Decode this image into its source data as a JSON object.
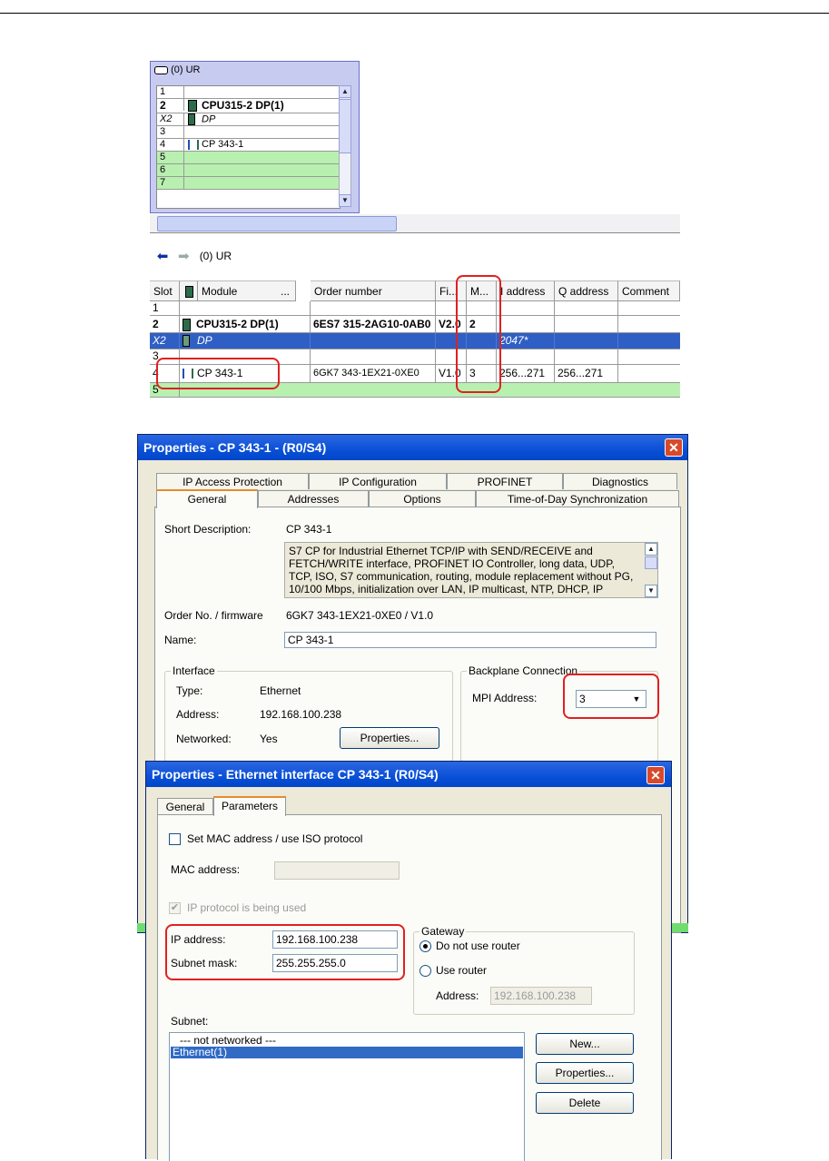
{
  "rack": {
    "title": "(0) UR",
    "rows": [
      {
        "slot": "1",
        "module": ""
      },
      {
        "slot": "2",
        "module": "CPU315-2 DP(1)"
      },
      {
        "slot": "X2",
        "module": "DP"
      },
      {
        "slot": "3",
        "module": ""
      },
      {
        "slot": "4",
        "module": "CP 343-1"
      },
      {
        "slot": "5",
        "module": ""
      },
      {
        "slot": "6",
        "module": ""
      },
      {
        "slot": "7",
        "module": ""
      }
    ]
  },
  "detail": {
    "nav_title": "(0)  UR",
    "headers": [
      "Slot",
      "Module",
      "...",
      "Order number",
      "Fi...",
      "M...",
      "I address",
      "Q address",
      "Comment"
    ],
    "rows": [
      {
        "slot": "1",
        "module": "",
        "order": "",
        "fw": "",
        "mpi": "",
        "i_addr": "",
        "q_addr": "",
        "comment": ""
      },
      {
        "slot": "2",
        "module": "CPU315-2 DP(1)",
        "order": "6ES7 315-2AG10-0AB0",
        "fw": "V2.0",
        "mpi": "2",
        "i_addr": "",
        "q_addr": "",
        "comment": ""
      },
      {
        "slot": "X2",
        "module": "DP",
        "order": "",
        "fw": "",
        "mpi": "",
        "i_addr": "2047*",
        "q_addr": "",
        "comment": ""
      },
      {
        "slot": "3",
        "module": "",
        "order": "",
        "fw": "",
        "mpi": "",
        "i_addr": "",
        "q_addr": "",
        "comment": ""
      },
      {
        "slot": "4",
        "module": "CP 343-1",
        "order": "6GK7 343-1EX21-0XE0",
        "fw": "V1.0",
        "mpi": "3",
        "i_addr": "256...271",
        "q_addr": "256...271",
        "comment": ""
      },
      {
        "slot": "5",
        "module": "",
        "order": "",
        "fw": "",
        "mpi": "",
        "i_addr": "",
        "q_addr": "",
        "comment": ""
      }
    ]
  },
  "props": {
    "title": "Properties - CP 343-1 - (R0/S4)",
    "tabs_back": [
      "IP Access Protection",
      "IP Configuration",
      "PROFINET",
      "Diagnostics"
    ],
    "tabs_front": [
      "General",
      "Addresses",
      "Options",
      "Time-of-Day Synchronization"
    ],
    "short_desc_label": "Short Description:",
    "short_desc": "CP 343-1",
    "description": "S7 CP for Industrial Ethernet TCP/IP with SEND/RECEIVE and FETCH/WRITE interface, PROFINET IO Controller, long data, UDP, TCP, ISO, S7 communication, routing, module replacement without PG, 10/100 Mbps, initialization over LAN, IP multicast, NTP, DHCP, IP",
    "order_label": "Order No. / firmware",
    "order_value": "6GK7 343-1EX21-0XE0 / V1.0",
    "name_label": "Name:",
    "name_value": "CP 343-1",
    "interface": {
      "title": "Interface",
      "type_label": "Type:",
      "type_value": "Ethernet",
      "address_label": "Address:",
      "address_value": "192.168.100.238",
      "networked_label": "Networked:",
      "networked_value": "Yes",
      "properties_button": "Properties..."
    },
    "backplane": {
      "title": "Backplane Connection",
      "mpi_label": "MPI Address:",
      "mpi_value": "3"
    }
  },
  "eth": {
    "title": "Properties - Ethernet interface  CP 343-1 (R0/S4)",
    "tabs": [
      "General",
      "Parameters"
    ],
    "mac_check_label": "Set MAC address / use ISO protocol",
    "mac_label": "MAC address:",
    "mac_value": "",
    "ip_used_label": "IP protocol is being used",
    "ip_label": "IP address:",
    "ip_value": "192.168.100.238",
    "mask_label": "Subnet mask:",
    "mask_value": "255.255.255.0",
    "gateway": {
      "title": "Gateway",
      "no_router": "Do not use router",
      "use_router": "Use router",
      "address_label": "Address:",
      "address_value": "192.168.100.238"
    },
    "subnet_label": "Subnet:",
    "subnets": [
      "--- not networked ---",
      "Ethernet(1)"
    ],
    "buttons": {
      "new": "New...",
      "properties": "Properties...",
      "delete": "Delete"
    }
  },
  "colors": {
    "highlight_red": "#e02020",
    "title_blue": "#0a50d8",
    "selection": "#316ac5",
    "slot_green": "#b8f0b0"
  }
}
